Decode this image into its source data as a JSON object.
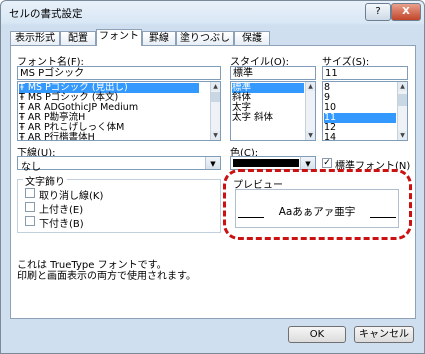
{
  "window": {
    "title": "セルの書式設定",
    "help": "?",
    "close": "X"
  },
  "tabs": [
    "表示形式",
    "配置",
    "フォント",
    "罫線",
    "塗りつぶし",
    "保護"
  ],
  "font": {
    "label": "フォント名(F):",
    "value": "MS Pゴシック",
    "items": [
      "MS Pゴシック (見出し)",
      "MS Pゴシック (本文)",
      "AR ADGothicJP Medium",
      "AR P勘亭流H",
      "AR Pれこげしっく体M",
      "AR P行楷書体H"
    ]
  },
  "style": {
    "label": "スタイル(O):",
    "value": "標準",
    "items": [
      "標準",
      "斜体",
      "太字",
      "太字 斜体"
    ]
  },
  "size": {
    "label": "サイズ(S):",
    "value": "11",
    "items": [
      "8",
      "9",
      "10",
      "11",
      "12",
      "14"
    ]
  },
  "underline": {
    "label": "下線(U):",
    "value": "なし"
  },
  "color": {
    "label": "色(C):",
    "value_color": "#000000",
    "normal_font_label": "標準フォント(N)",
    "normal_font_checked": "✓"
  },
  "effects": {
    "label": "文字飾り",
    "items": [
      "取り消し線(K)",
      "上付き(E)",
      "下付き(B)"
    ]
  },
  "preview": {
    "label": "プレビュー",
    "sample": "Aaあぁアァ亜宇"
  },
  "note": {
    "line1": "これは TrueType フォントです。",
    "line2": "印刷と画面表示の両方で使用されます。"
  },
  "buttons": {
    "ok": "OK",
    "cancel": "キャンセル"
  }
}
